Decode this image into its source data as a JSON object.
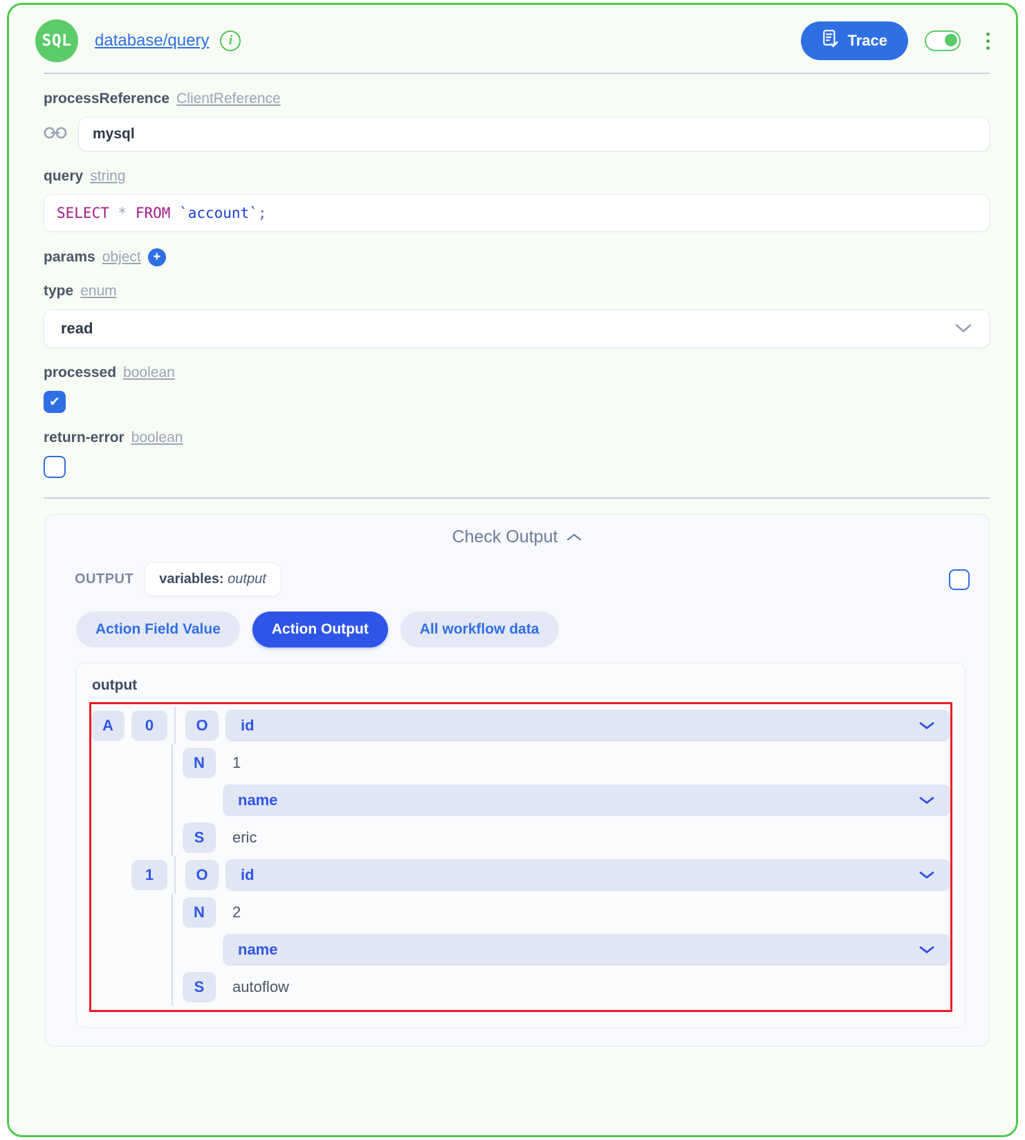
{
  "node": {
    "badge": "SQL",
    "title": "database/query",
    "info_icon": "i",
    "trace_label": "Trace",
    "toggle_state": "on",
    "accent_green": "#4fc94f",
    "accent_blue": "#2f6fe4"
  },
  "fields": [
    {
      "name": "processReference",
      "type": "ClientReference",
      "control": "text",
      "value": "mysql",
      "icon": "link-icon"
    },
    {
      "name": "query",
      "type": "string",
      "control": "code",
      "value": "SELECT * FROM `account`;",
      "tokens": [
        {
          "t": "SELECT",
          "c": "kw"
        },
        {
          "t": "*",
          "c": "op"
        },
        {
          "t": "FROM",
          "c": "kw"
        },
        {
          "t": "`account`",
          "c": "ident"
        },
        {
          "t": ";",
          "c": "punct"
        }
      ]
    },
    {
      "name": "params",
      "type": "object",
      "control": "add",
      "add_icon": "plus-circle-icon"
    },
    {
      "name": "type",
      "type": "enum",
      "control": "select",
      "value": "read"
    },
    {
      "name": "processed",
      "type": "boolean",
      "control": "checkbox",
      "checked": true
    },
    {
      "name": "return-error",
      "type": "boolean",
      "control": "checkbox",
      "checked": false
    }
  ],
  "check_output": {
    "title": "Check Output",
    "collapse_icon": "chevron-up-icon",
    "output_label": "OUTPUT",
    "variable_chip_key": "variables:",
    "variable_chip_value": "output",
    "tabs": [
      {
        "label": "Action Field Value",
        "active": false
      },
      {
        "label": "Action Output",
        "active": true
      },
      {
        "label": "All workflow data",
        "active": false
      }
    ],
    "tree_root_label": "output",
    "highlight_color": "#ee1c25",
    "tree": {
      "root_tag": "A",
      "items": [
        {
          "index": "0",
          "obj_tag": "O",
          "pairs": [
            {
              "key": "id",
              "type_tag": "N",
              "value": "1"
            },
            {
              "key": "name",
              "type_tag": "S",
              "value": "eric"
            }
          ]
        },
        {
          "index": "1",
          "obj_tag": "O",
          "pairs": [
            {
              "key": "id",
              "type_tag": "N",
              "value": "2"
            },
            {
              "key": "name",
              "type_tag": "S",
              "value": "autoflow"
            }
          ]
        }
      ]
    }
  }
}
